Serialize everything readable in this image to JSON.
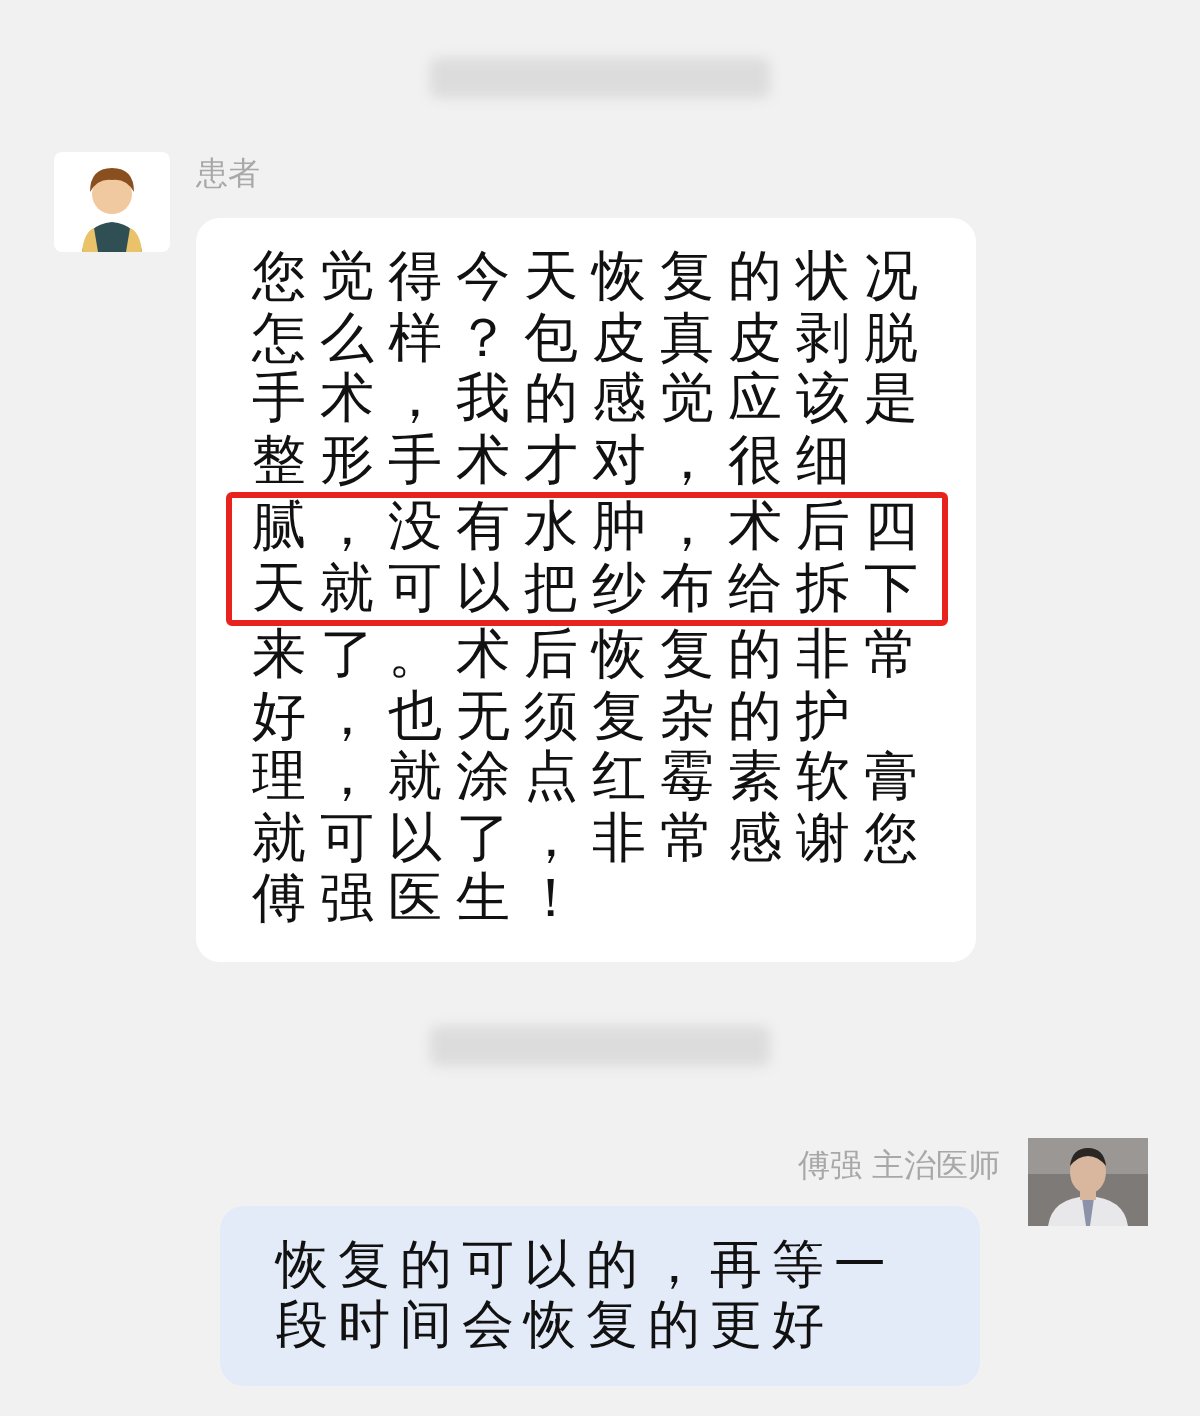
{
  "messages": [
    {
      "kind": "blurred_time"
    },
    {
      "kind": "incoming",
      "sender": "患者",
      "lines": [
        {
          "text": "您觉得今天恢复的状况",
          "highlighted": false
        },
        {
          "text": "怎么样？包皮真皮剥脱",
          "highlighted": false
        },
        {
          "text": "手术，我的感觉应该是",
          "highlighted": false
        },
        {
          "text": "整形手术才对，很细",
          "highlighted": false
        },
        {
          "text": "腻，没有水肿，术后四",
          "highlighted": true
        },
        {
          "text": "天就可以把纱布给拆下",
          "highlighted": true
        },
        {
          "text": "来了。术后恢复的非常",
          "highlighted": false
        },
        {
          "text": "好，也无须复杂的护",
          "highlighted": false
        },
        {
          "text": "理，就涂点红霉素软膏",
          "highlighted": false
        },
        {
          "text": "就可以了，非常感谢您",
          "highlighted": false
        },
        {
          "text": "傅强医生！",
          "highlighted": false
        }
      ]
    },
    {
      "kind": "blurred_time"
    },
    {
      "kind": "outgoing",
      "sender": "傅强 主治医师",
      "lines": [
        {
          "text": "恢复的可以的，再等一",
          "highlighted": false
        },
        {
          "text": "段时间会恢复的更好",
          "highlighted": false
        }
      ]
    }
  ]
}
